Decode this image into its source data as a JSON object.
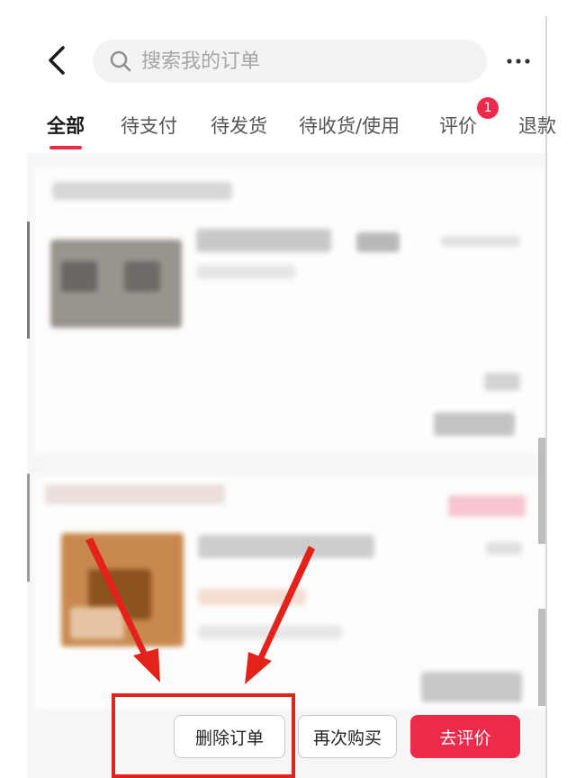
{
  "header": {
    "back_icon": "chevron-left-icon",
    "search_placeholder": "搜索我的订单",
    "search_icon": "search-icon",
    "more_icon": "more-horizontal-icon"
  },
  "tabs": [
    {
      "label": "全部",
      "active": true
    },
    {
      "label": "待支付"
    },
    {
      "label": "待发货"
    },
    {
      "label": "待收货/使用"
    },
    {
      "label": "评价",
      "badge": "1"
    },
    {
      "label": "退款"
    }
  ],
  "order_actions": {
    "delete_label": "删除订单",
    "rebuy_label": "再次购买",
    "review_label": "去评价"
  },
  "colors": {
    "accent": "#ee2a4a",
    "annotation": "#e3231b"
  }
}
